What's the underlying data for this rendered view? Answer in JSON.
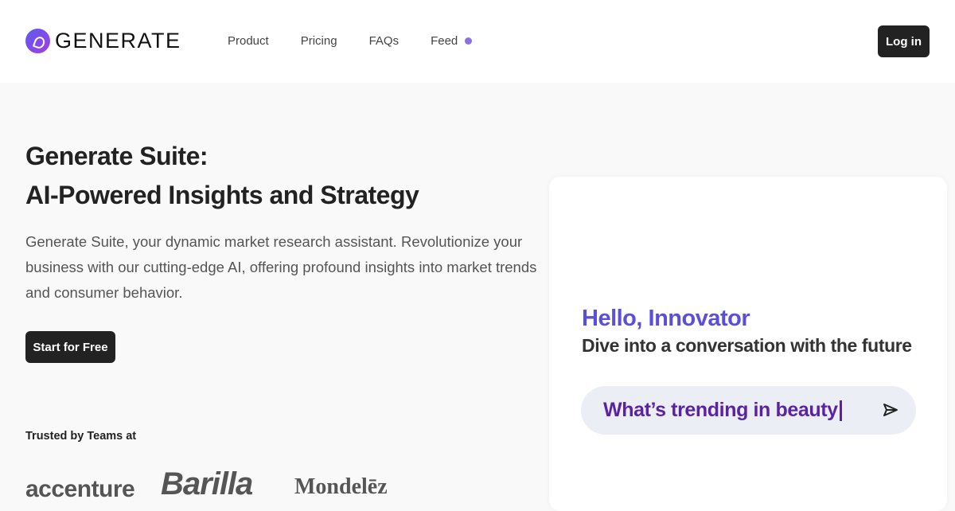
{
  "header": {
    "brand": "GENERATE",
    "nav": [
      "Product",
      "Pricing",
      "FAQs",
      "Feed"
    ],
    "login": "Log in"
  },
  "hero": {
    "title_line1": "Generate Suite:",
    "title_line2": "AI-Powered Insights and Strategy",
    "description": "Generate Suite, your dynamic market research assistant. Revolutionize your business with our cutting-edge AI, offering profound insights into market trends and consumer behavior.",
    "cta": "Start for Free"
  },
  "trusted": {
    "label": "Trusted by Teams at",
    "brands": [
      "accenture",
      "Barilla",
      "Mondelēz"
    ]
  },
  "chat": {
    "greeting": "Hello, Innovator",
    "subtitle": "Dive into a conversation with the future",
    "prompt": "What’s trending in beauty"
  },
  "colors": {
    "accent": "#5a4fd8",
    "prompt": "#5a24a0",
    "dark": "#222222"
  }
}
